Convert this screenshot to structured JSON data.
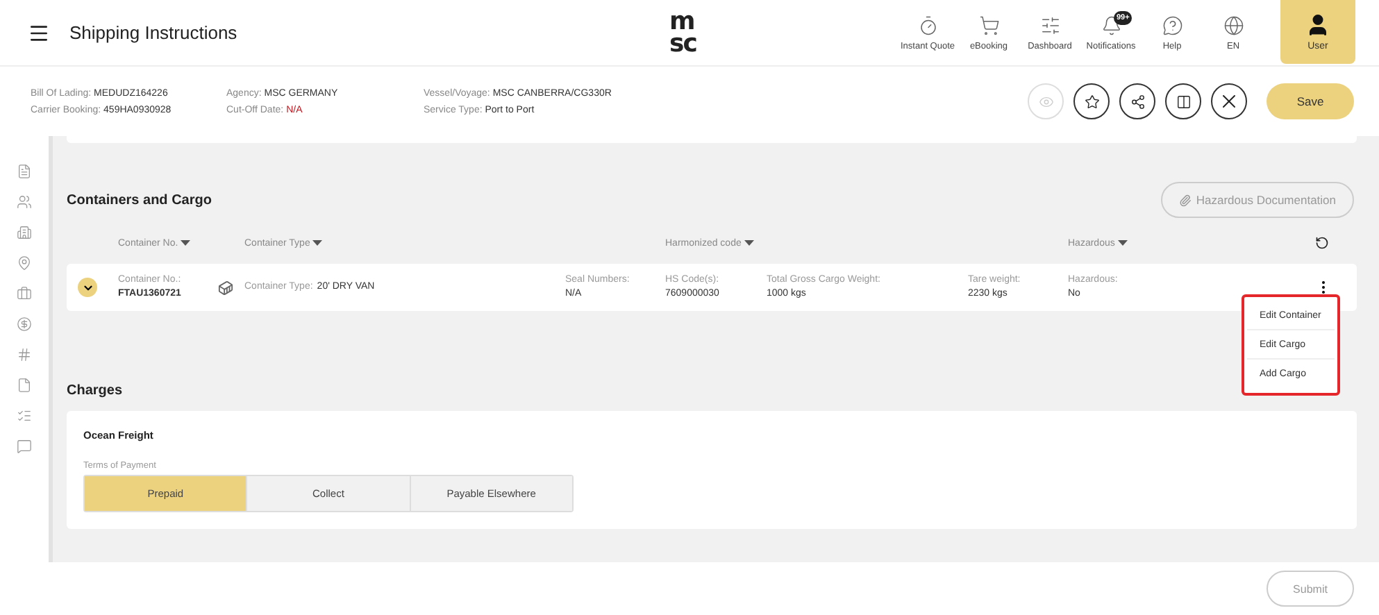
{
  "header": {
    "title": "Shipping Instructions",
    "logo": "msc",
    "nav": [
      {
        "kind": "quote",
        "label": "Instant Quote"
      },
      {
        "kind": "cart",
        "label": "eBooking"
      },
      {
        "kind": "sliders",
        "label": "Dashboard"
      },
      {
        "kind": "bell",
        "label": "Notifications",
        "badge": "99+"
      },
      {
        "kind": "help",
        "label": "Help"
      },
      {
        "kind": "globe",
        "label": "EN"
      }
    ],
    "user": "User"
  },
  "info": [
    [
      {
        "label": "Bill Of Lading:",
        "value": "MEDUDZ164226",
        "alert": false
      },
      {
        "label": "Carrier Booking:",
        "value": "459HA0930928",
        "alert": false
      }
    ],
    [
      {
        "label": "Agency:",
        "value": "MSC GERMANY",
        "alert": false
      },
      {
        "label": "Cut-Off Date:",
        "value": "N/A",
        "alert": true
      }
    ],
    [
      {
        "label": "Vessel/Voyage:",
        "value": "MSC CANBERRA/CG330R",
        "alert": false
      },
      {
        "label": "Service Type:",
        "value": "Port to Port",
        "alert": false
      }
    ]
  ],
  "actions": [
    {
      "kind": "view",
      "disabled": true
    },
    {
      "kind": "star",
      "disabled": false
    },
    {
      "kind": "share",
      "disabled": false
    },
    {
      "kind": "compare",
      "disabled": false
    },
    {
      "kind": "close",
      "disabled": false
    }
  ],
  "save": "Save",
  "sidebar": [
    {
      "kind": "document"
    },
    {
      "kind": "people"
    },
    {
      "kind": "building"
    },
    {
      "kind": "pin"
    },
    {
      "kind": "briefcase"
    },
    {
      "kind": "dollar"
    },
    {
      "kind": "hash"
    },
    {
      "kind": "file"
    },
    {
      "kind": "checklist"
    },
    {
      "kind": "message"
    }
  ],
  "containers": {
    "title": "Containers and Cargo",
    "hazardous_button": {
      "label": "Hazardous Documentation",
      "disabled": true
    },
    "columns": [
      {
        "label": "Container No."
      },
      {
        "label": "Container Type"
      },
      {
        "label": "Harmonized code"
      },
      {
        "label": "Hazardous"
      }
    ],
    "rows": [
      {
        "expanded": false,
        "fields": [
          {
            "kind": "stacked",
            "label": "Container No.:",
            "value": "FTAU1360721"
          },
          {
            "kind": "inline",
            "label": "Container Type:",
            "value": "20' DRY VAN"
          },
          {
            "kind": "stacked",
            "label": "Seal Numbers:",
            "value": "N/A"
          },
          {
            "kind": "stacked",
            "label": "HS Code(s):",
            "value": "7609000030"
          },
          {
            "kind": "stacked",
            "label": "Total Gross Cargo Weight:",
            "value": "1000 kgs"
          },
          {
            "kind": "stacked",
            "label": "Tare weight:",
            "value": "2230 kgs"
          },
          {
            "kind": "stacked",
            "label": "Hazardous:",
            "value": "No"
          }
        ],
        "menu": [
          "Edit Container",
          "Edit Cargo",
          "Add Cargo"
        ]
      }
    ]
  },
  "charges": {
    "title": "Charges",
    "card_title": "Ocean Freight",
    "terms_label": "Terms of Payment",
    "options": [
      {
        "label": "Prepaid",
        "selected": true
      },
      {
        "label": "Collect",
        "selected": false
      },
      {
        "label": "Payable Elsewhere",
        "selected": false
      }
    ]
  },
  "submit": {
    "label": "Submit",
    "disabled": true
  }
}
